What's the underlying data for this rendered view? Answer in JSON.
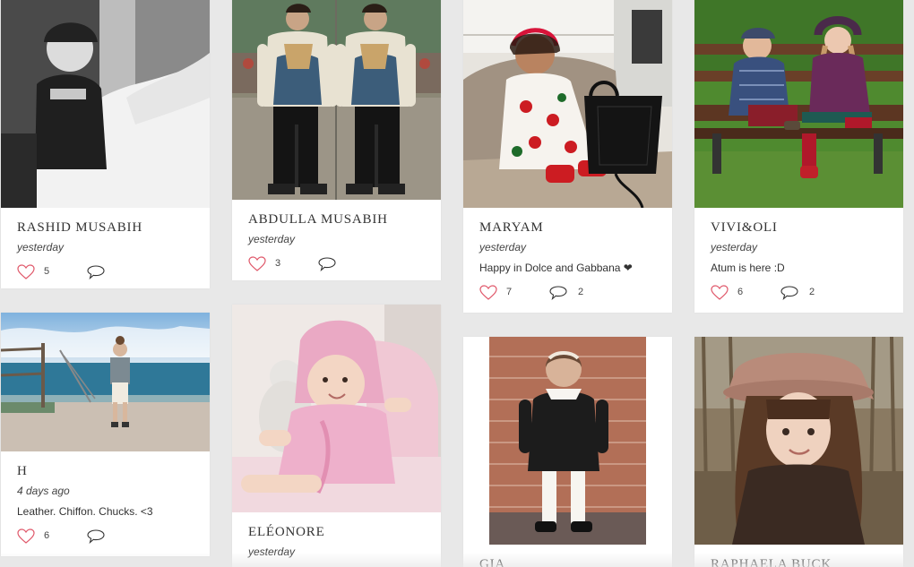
{
  "colors": {
    "background": "#e8e8e8",
    "card": "#ffffff",
    "like_icon": "#e0586a",
    "comment_icon": "#333333"
  },
  "cards": [
    {
      "name": "RASHID MUSABIH",
      "time": "yesterday",
      "caption": "",
      "likes": "5",
      "comments": "",
      "photo": "boy-in-helmet-on-white-horse"
    },
    {
      "name": "ABDULLA MUSABIH",
      "time": "yesterday",
      "caption": "",
      "likes": "3",
      "comments": "",
      "photo": "mirrored-boy-in-sweatshirt"
    },
    {
      "name": "MARYAM",
      "time": "yesterday",
      "caption": "Happy in Dolce and Gabbana ❤",
      "likes": "7",
      "comments": "2",
      "photo": "baby-girl-with-black-handbag"
    },
    {
      "name": "VIVI&OLI",
      "time": "yesterday",
      "caption": "Atum is here :D",
      "likes": "6",
      "comments": "2",
      "photo": "two-kids-on-park-bench"
    },
    {
      "name": "H",
      "time": "4 days ago",
      "caption": "Leather. Chiffon. Chucks. <3",
      "likes": "6",
      "comments": "",
      "photo": "girl-at-seaside"
    },
    {
      "name": "ELÉONORE",
      "time": "yesterday",
      "caption": "",
      "likes": "",
      "comments": "",
      "photo": "baby-in-pink-robe"
    },
    {
      "name": "GIA",
      "time": "",
      "caption": "",
      "likes": "",
      "comments": "",
      "photo": "girl-by-brick-wall"
    },
    {
      "name": "RAPHAELA BUCK",
      "time": "",
      "caption": "",
      "likes": "",
      "comments": "",
      "photo": "girl-in-felt-hat"
    }
  ]
}
